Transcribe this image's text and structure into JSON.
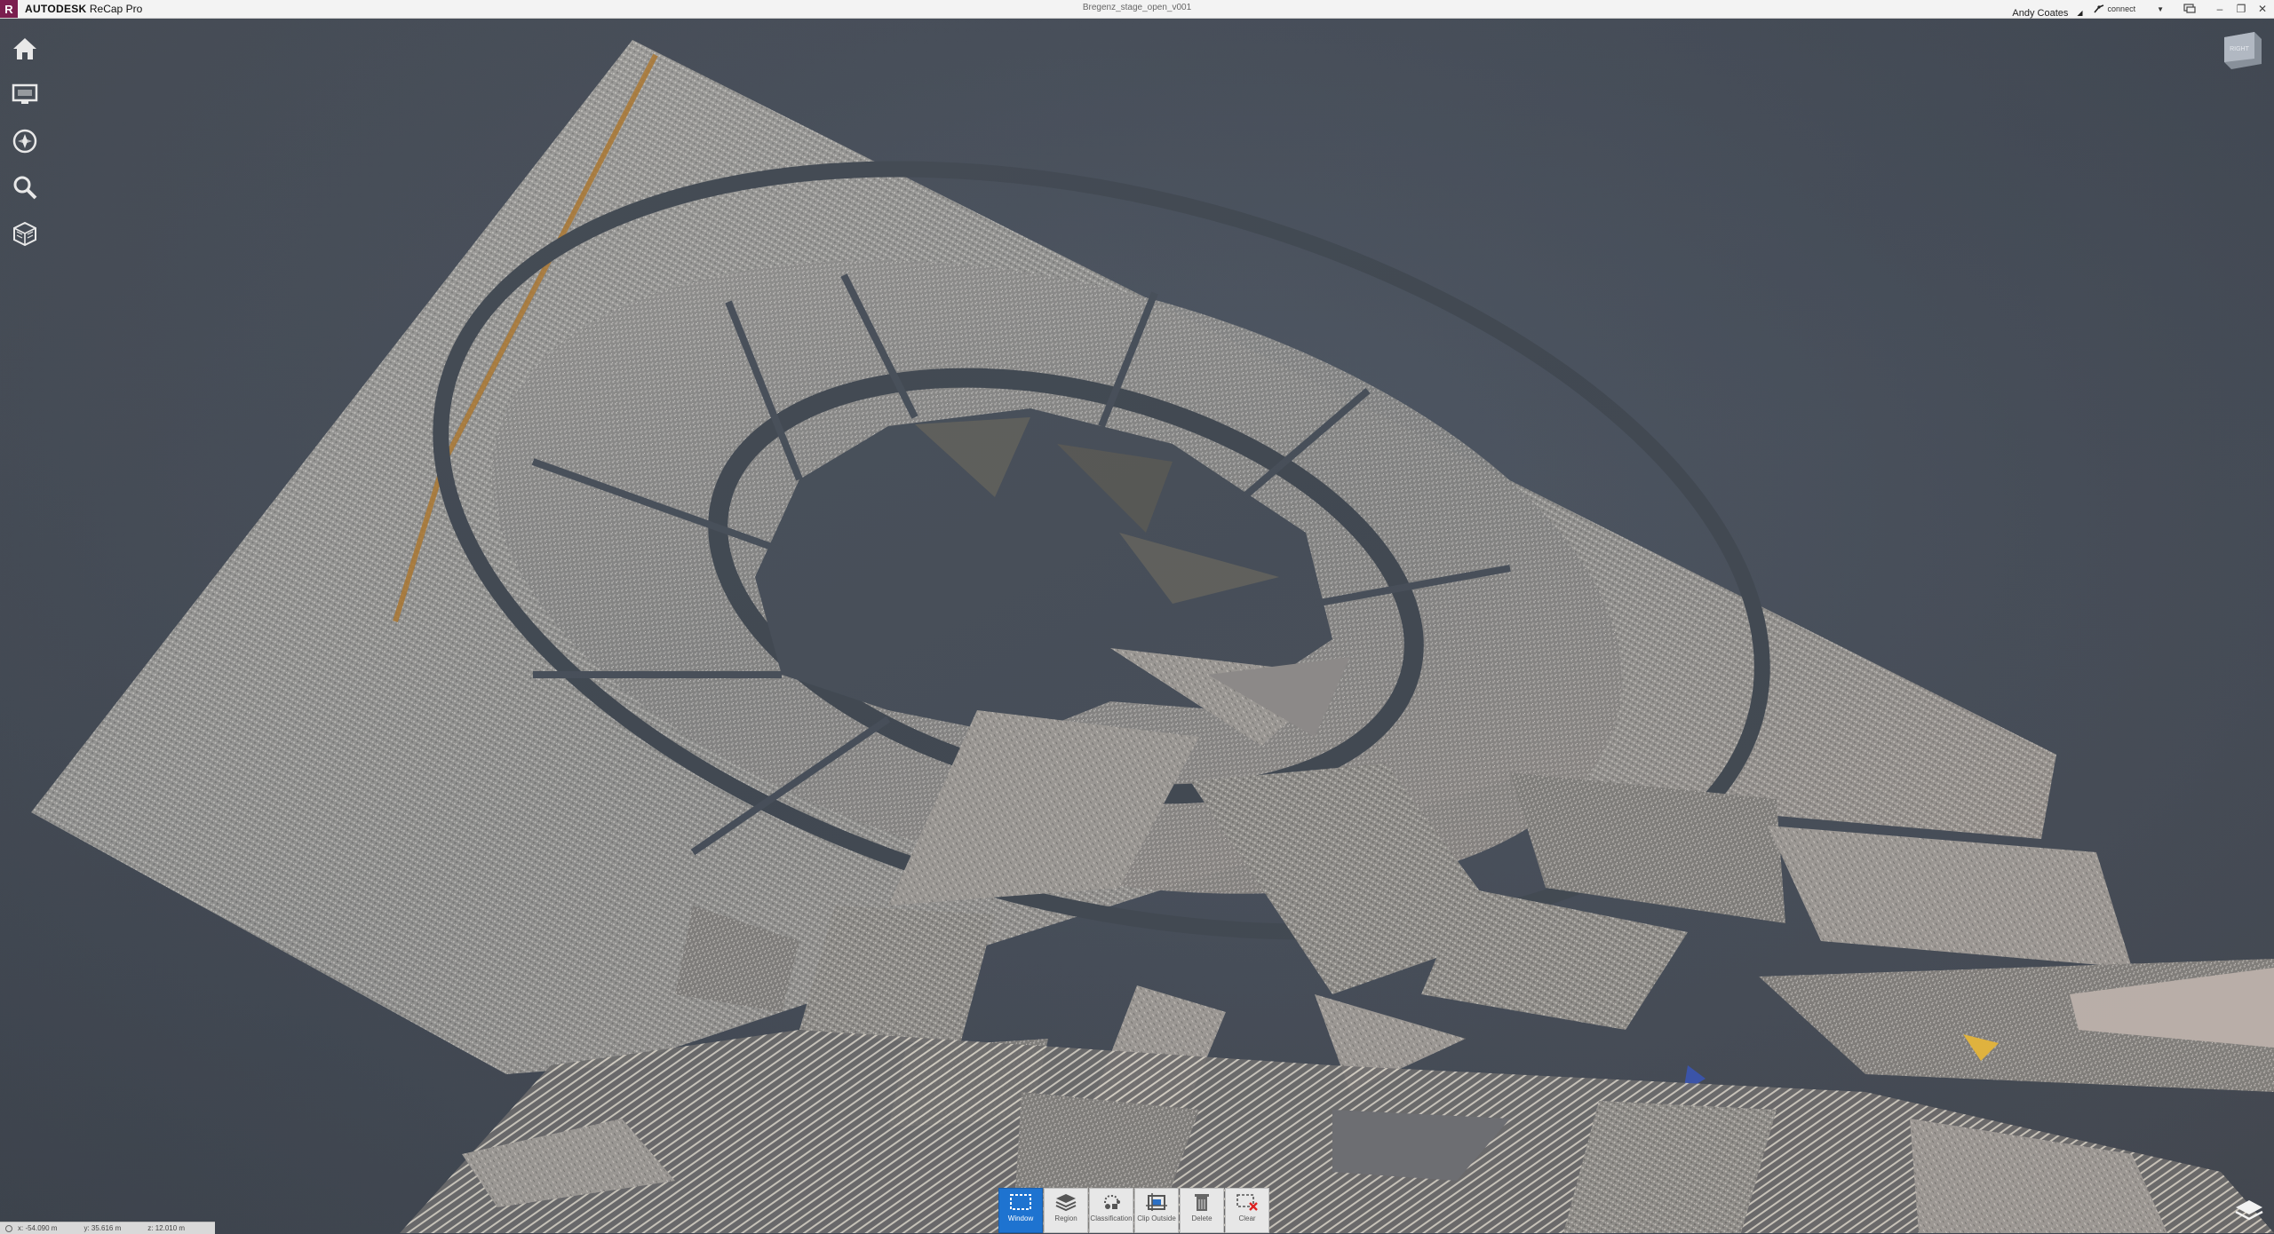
{
  "app": {
    "logo_letter": "R",
    "brand_name": "AUTODESK",
    "product_name": "ReCap Pro",
    "document_title": "Bregenz_stage_open_v001"
  },
  "titlebar": {
    "user_name": "Andy Coates",
    "connect_label": "connect"
  },
  "left_toolbar": {
    "tools": [
      "home-icon",
      "display-monitor-icon",
      "navigation-wheel-icon",
      "search-icon",
      "scan-region-cube-icon"
    ]
  },
  "viewcube": {
    "face_label": "RIGHT"
  },
  "bottom_toolbar": {
    "items": [
      {
        "label": "Window",
        "icon": "window-select-icon",
        "active": true
      },
      {
        "label": "Region",
        "icon": "region-layers-icon",
        "active": false
      },
      {
        "label": "Classification",
        "icon": "classification-icon",
        "active": false
      },
      {
        "label": "Clip Outside",
        "icon": "clip-outside-icon",
        "active": false
      },
      {
        "label": "Delete",
        "icon": "trash-icon",
        "active": false
      },
      {
        "label": "Clear",
        "icon": "clear-selection-icon",
        "active": false
      }
    ]
  },
  "status_bar": {
    "x": "x: -54.090 m",
    "y": "y: 35.616 m",
    "z": "z: 12.010 m"
  },
  "colors": {
    "viewport_bg": "#434a55",
    "accent": "#1e73d0",
    "logo": "#7a1f4f"
  }
}
